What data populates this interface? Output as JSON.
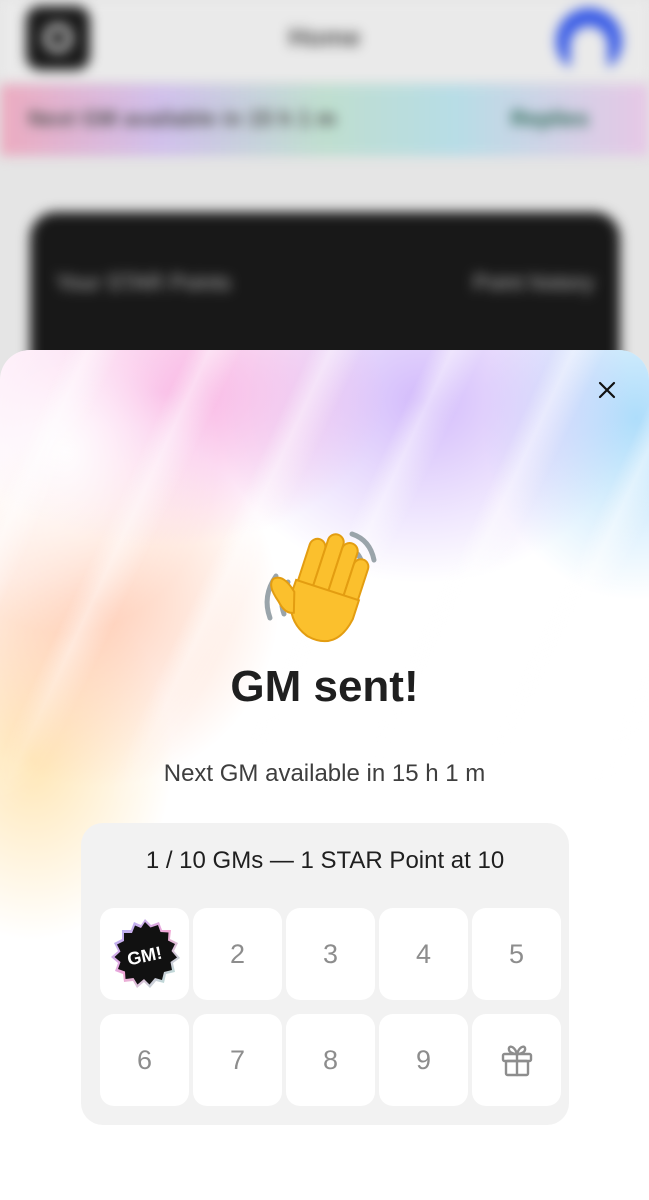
{
  "background": {
    "header_title": "Home",
    "banner_text": "Next GM available in 15 h 1 m",
    "banner_link": "Replies",
    "card_left": "Your STAR Points",
    "card_right": "Point history"
  },
  "sheet": {
    "title": "GM sent!",
    "subtitle": "Next GM available in 15 h 1 m",
    "progress_text": "1 / 10 GMs — 1 STAR Point at 10",
    "badge_text": "GM!",
    "cells": [
      "2",
      "3",
      "4",
      "5",
      "6",
      "7",
      "8",
      "9"
    ],
    "icons": {
      "close": "close-icon",
      "wave": "waving-hand-icon",
      "badge": "gm-badge-icon",
      "gift": "gift-icon"
    },
    "colors": {
      "title": "#1f1f1f",
      "card": "#f2f2f2",
      "cell_text": "#8d8d8d",
      "badge": "#111111"
    }
  }
}
